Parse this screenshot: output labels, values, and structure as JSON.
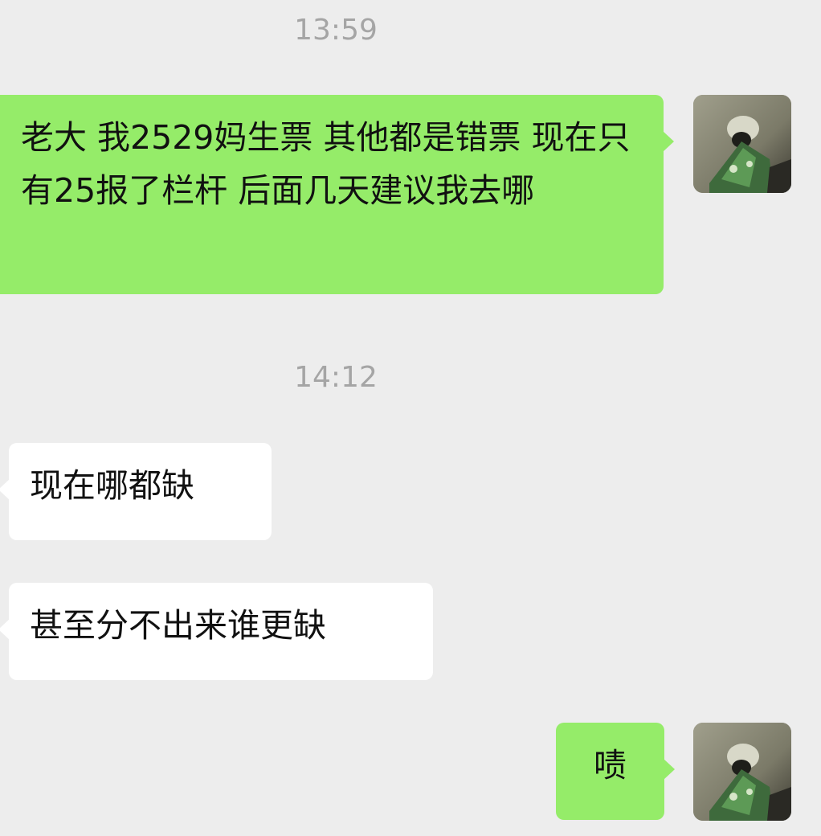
{
  "chat": {
    "timestamps": [
      "13:59",
      "14:12"
    ],
    "messages": [
      {
        "sender": "me",
        "text": "老大 我2529妈生票 其他都是错票 现在只有25报了栏杆 后面几天建议我去哪"
      },
      {
        "sender": "other",
        "text": "现在哪都缺"
      },
      {
        "sender": "other",
        "text": "甚至分不出来谁更缺"
      },
      {
        "sender": "me",
        "text": "啧"
      }
    ]
  },
  "colors": {
    "background": "#ededed",
    "outgoing_bubble": "#95ec69",
    "incoming_bubble": "#ffffff",
    "timestamp_text": "#a5a5a5"
  }
}
